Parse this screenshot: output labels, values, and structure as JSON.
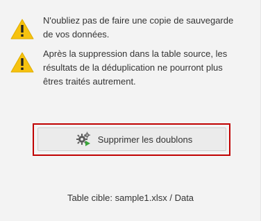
{
  "warnings": [
    {
      "icon": "warning-triangle-icon",
      "text": "N'oubliez pas de faire une copie de sauvegarde\nde vos données."
    },
    {
      "icon": "warning-triangle-icon",
      "text": "Après la suppression dans la table source, les\nrésultats de la déduplication ne pourront plus\nêtres traités autrement."
    }
  ],
  "action": {
    "icon": "gears-run-icon",
    "label": "Supprimer les doublons"
  },
  "target": {
    "label": "Table cible: sample1.xlsx / Data"
  },
  "colors": {
    "background": "#f3f3f3",
    "warning_yellow": "#f6c20f",
    "highlight_red": "#c00000",
    "button_bg": "#ebebeb",
    "gear_gray": "#5a5a5a",
    "arrow_green": "#3aa53a"
  }
}
